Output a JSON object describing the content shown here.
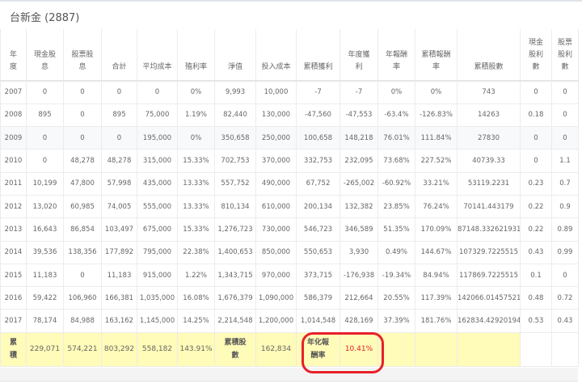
{
  "title": "台新金 (2887)",
  "headers": [
    "年度",
    "現金股息",
    "股票股息",
    "合計",
    "平均成本",
    "殖利率",
    "淨值",
    "投入成本",
    "累積獲利",
    "年度獲利",
    "年報酬率",
    "累積報酬率",
    "累積股數",
    "現金股利數",
    "股票股利數"
  ],
  "rows": [
    [
      "2007",
      "0",
      "0",
      "0",
      "0",
      "0%",
      "9,993",
      "10,000",
      "-7",
      "-7",
      "0%",
      "0%",
      "743",
      "0",
      "0"
    ],
    [
      "2008",
      "895",
      "0",
      "895",
      "75,000",
      "1.19%",
      "82,440",
      "130,000",
      "-47,560",
      "-47,553",
      "-63.4%",
      "-126.83%",
      "14263",
      "0.18",
      "0"
    ],
    [
      "2009",
      "0",
      "0",
      "0",
      "195,000",
      "0%",
      "350,658",
      "250,000",
      "100,658",
      "148,218",
      "76.01%",
      "111.84%",
      "27830",
      "0",
      "0"
    ],
    [
      "2010",
      "0",
      "48,278",
      "48,278",
      "315,000",
      "15.33%",
      "702,753",
      "370,000",
      "332,753",
      "232,095",
      "73.68%",
      "227.52%",
      "40739.33",
      "0",
      "1.1"
    ],
    [
      "2011",
      "10,199",
      "47,800",
      "57,998",
      "435,000",
      "13.33%",
      "557,752",
      "490,000",
      "67,752",
      "-265,002",
      "-60.92%",
      "33.21%",
      "53119.2231",
      "0.23",
      "0.7"
    ],
    [
      "2012",
      "13,020",
      "60,985",
      "74,005",
      "555,000",
      "13.33%",
      "810,134",
      "610,000",
      "200,134",
      "132,382",
      "23.85%",
      "76.24%",
      "70141.443179",
      "0.22",
      "0.9"
    ],
    [
      "2013",
      "16,643",
      "86,854",
      "103,497",
      "675,000",
      "15.33%",
      "1,276,723",
      "730,000",
      "546,723",
      "346,589",
      "51.35%",
      "170.09%",
      "87148.332621931",
      "0.22",
      "0.89"
    ],
    [
      "2014",
      "39,536",
      "138,356",
      "177,892",
      "795,000",
      "22.38%",
      "1,400,653",
      "850,000",
      "550,653",
      "3,930",
      "0.49%",
      "144.67%",
      "107329.7225515",
      "0.43",
      "0.99"
    ],
    [
      "2015",
      "11,183",
      "0",
      "11,183",
      "915,000",
      "1.22%",
      "1,343,715",
      "970,000",
      "373,715",
      "-176,938",
      "-19.34%",
      "84.94%",
      "117869.7225515",
      "0.1",
      "0"
    ],
    [
      "2016",
      "59,422",
      "106,960",
      "166,381",
      "1,035,000",
      "16.08%",
      "1,676,379",
      "1,090,000",
      "586,379",
      "212,664",
      "20.55%",
      "117.39%",
      "142066.01457521",
      "0.48",
      "0.72"
    ],
    [
      "2017",
      "78,174",
      "84,988",
      "163,162",
      "1,145,000",
      "14.25%",
      "2,214,548",
      "1,200,000",
      "1,014,548",
      "428,169",
      "37.39%",
      "181.76%",
      "162834.42920194",
      "0.53",
      "0.43"
    ]
  ],
  "summary": {
    "label": "累積",
    "cash": "229,071",
    "stock": "574,221",
    "total": "803,292",
    "avg_cost": "558,182",
    "yield": "143.91%",
    "shares_label": "累積股數",
    "shares": "162,834",
    "annual_label": "年化報酬率",
    "annual": "10.41%"
  }
}
